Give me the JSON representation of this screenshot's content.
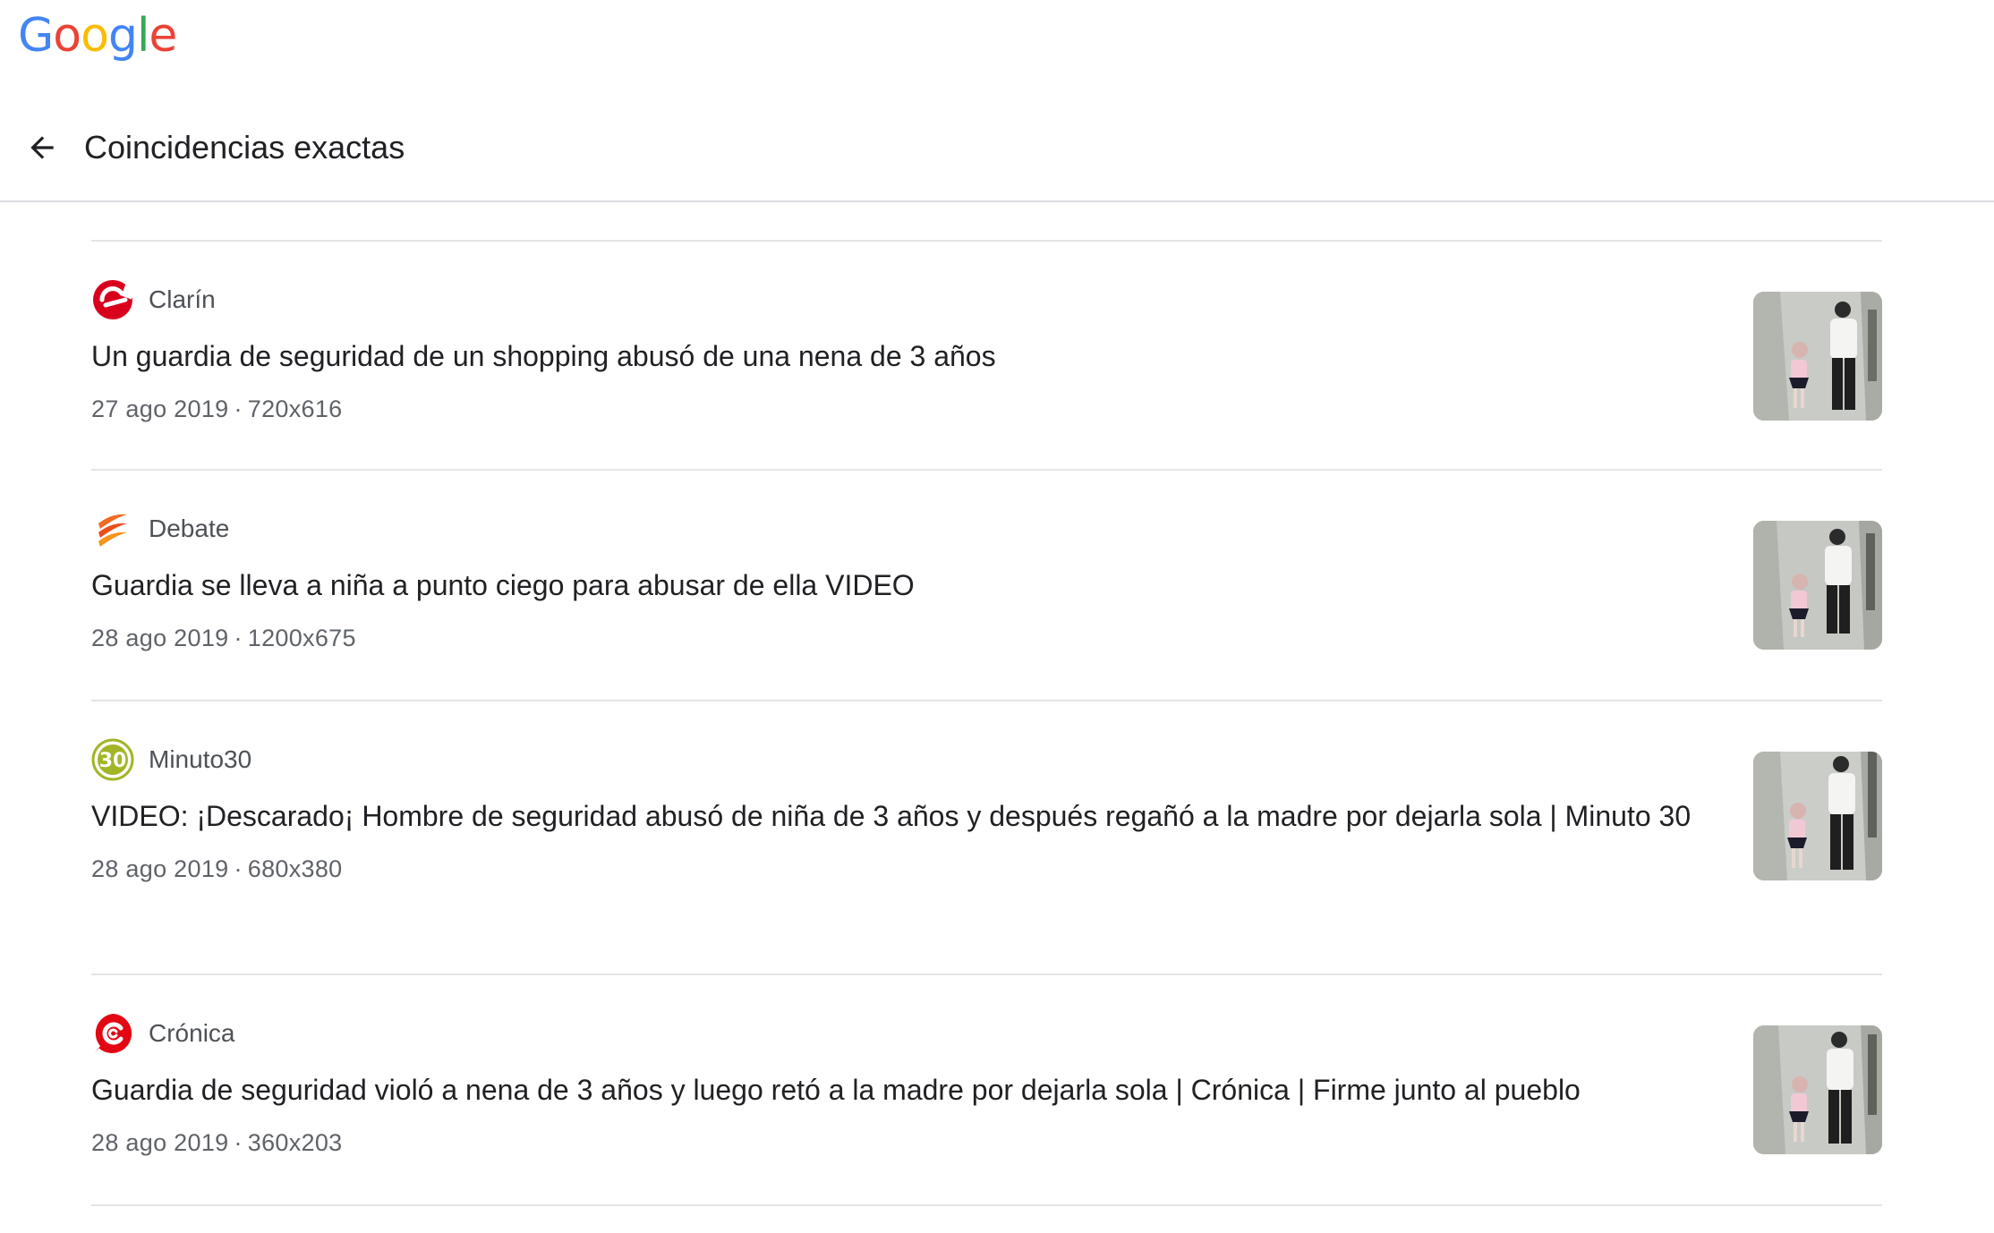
{
  "brand": {
    "logo_letters": [
      "G",
      "o",
      "o",
      "g",
      "l",
      "e"
    ],
    "logo_colors": [
      "#4285F4",
      "#EA4335",
      "#FBBC05",
      "#4285F4",
      "#34A853",
      "#EA4335"
    ]
  },
  "header": {
    "back_icon": "arrow-left-icon",
    "title": "Coincidencias exactas"
  },
  "results": [
    {
      "source": "Clarín",
      "favicon": "clarin-logo-icon",
      "favicon_color": "#D9001E",
      "title": "Un guardia de seguridad de un shopping abusó de una nena de 3 años",
      "date": "27 ago 2019",
      "dimensions": "720x616"
    },
    {
      "source": "Debate",
      "favicon": "debate-logo-icon",
      "favicon_color": "#F26A21",
      "title": "Guardia se lleva a niña a punto ciego para abusar de ella VIDEO",
      "date": "28 ago 2019",
      "dimensions": "1200x675"
    },
    {
      "source": "Minuto30",
      "favicon": "minuto30-logo-icon",
      "favicon_color": "#A3B526",
      "title": "VIDEO: ¡Descarado¡ Hombre de seguridad abusó de niña de 3 años y después regañó a la madre por dejarla sola | Minuto 30",
      "date": "28 ago 2019",
      "dimensions": "680x380"
    },
    {
      "source": "Crónica",
      "favicon": "cronica-logo-icon",
      "favicon_color": "#E30613",
      "title": "Guardia de seguridad violó a nena de 3 años y luego retó a la madre por dejarla sola | Crónica | Firme junto al pueblo",
      "date": "28 ago 2019",
      "dimensions": "360x203"
    }
  ],
  "meta_separator": "·"
}
